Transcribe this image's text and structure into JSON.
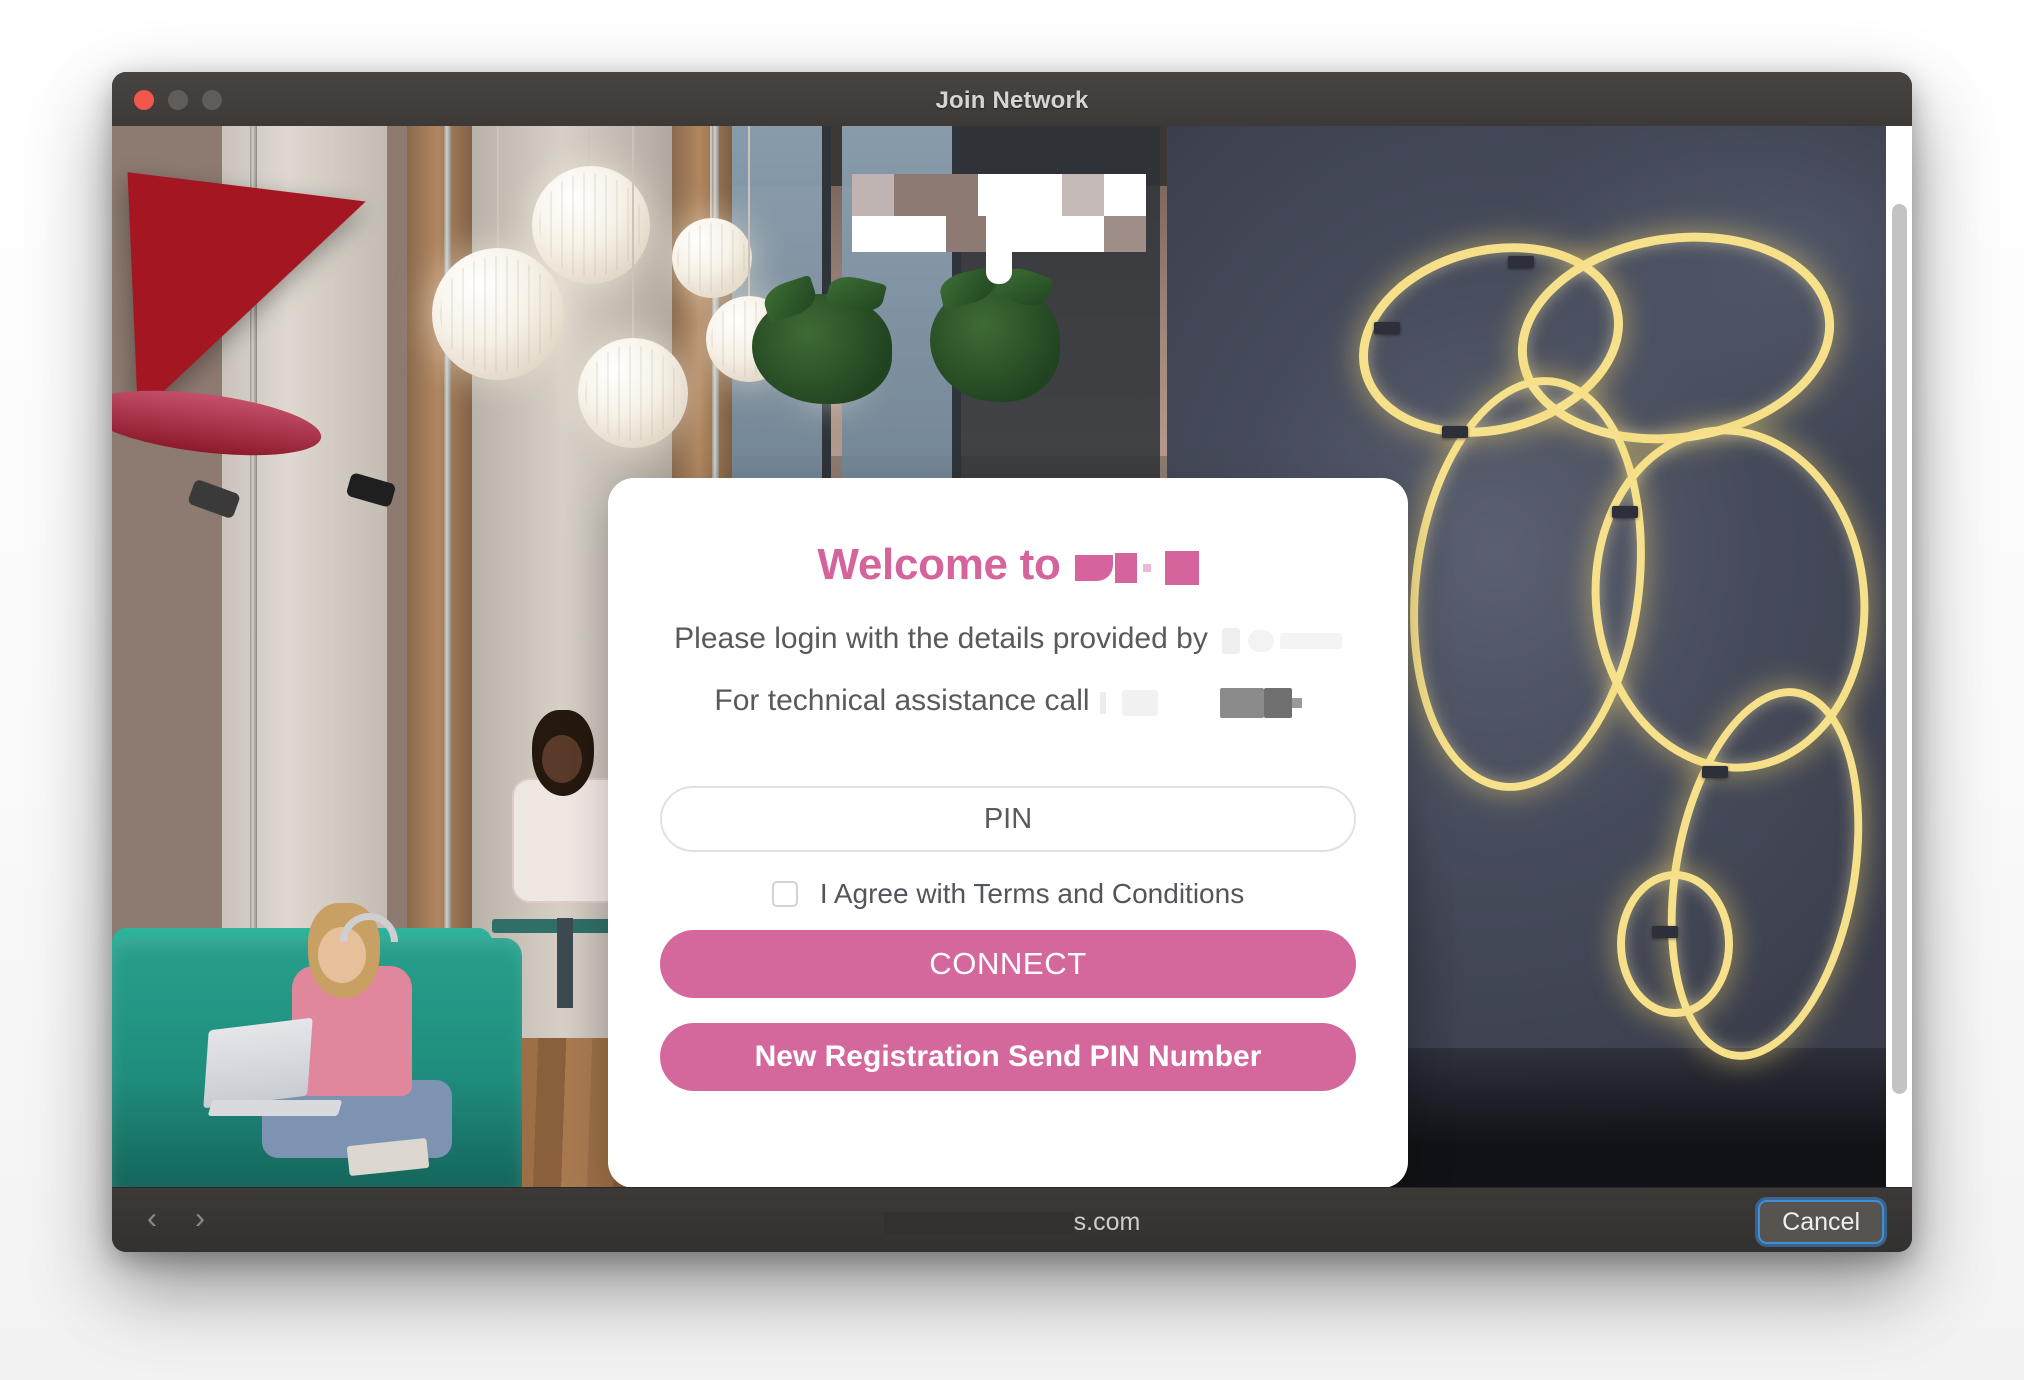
{
  "window": {
    "title": "Join Network",
    "traffic_lights": [
      {
        "name": "close",
        "color": "#f2564d"
      },
      {
        "name": "minimize",
        "color": "#5f5c5a"
      },
      {
        "name": "zoom",
        "color": "#5f5c5a"
      }
    ]
  },
  "portal": {
    "logo": {
      "redacted": true,
      "style": "pixelated-mosaic"
    },
    "card": {
      "heading_text": "Welcome to",
      "heading_redacted": true,
      "heading_color": "#d4649b",
      "line1_text": "Please login with the details provided by",
      "line1_redacted": true,
      "line2_text": "For technical assistance call",
      "line2_redacted": true,
      "pin_input": {
        "label": "PIN",
        "value": "",
        "placeholder": "PIN"
      },
      "terms": {
        "label": "I Agree with Terms and Conditions",
        "checked": false
      },
      "connect_button": "CONNECT",
      "register_button": "New Registration Send PIN Number",
      "button_color": "#d4689d"
    }
  },
  "toolbar": {
    "back_icon": "‹",
    "forward_icon": "›",
    "url_visible_suffix": "s.com",
    "url_redacted": true,
    "cancel_label": "Cancel",
    "focus_ring_color": "#3f8fd8"
  },
  "scrollbar": {
    "orientation": "vertical",
    "thumb_color": "#c3c3c3"
  }
}
